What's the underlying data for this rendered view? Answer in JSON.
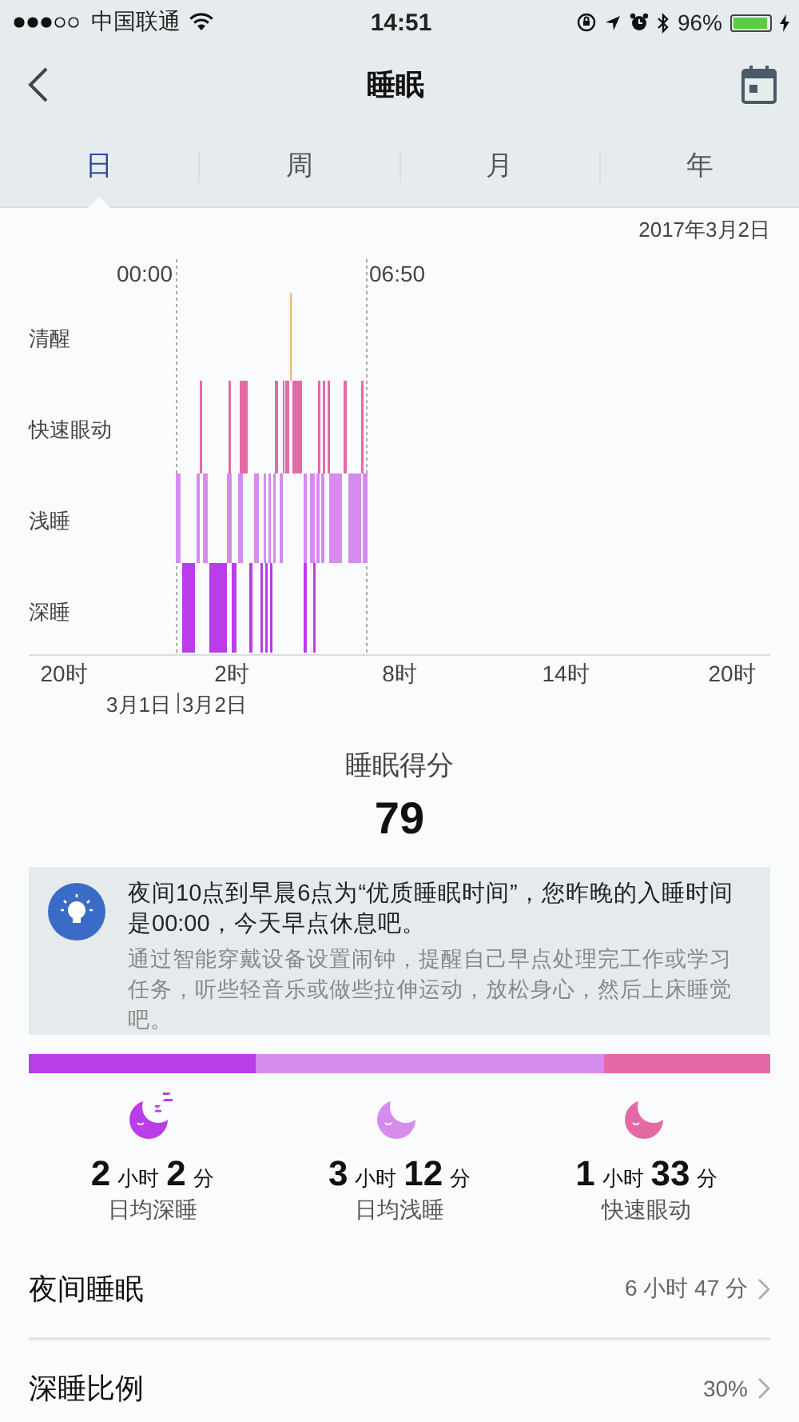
{
  "status_bar": {
    "carrier": "中国联通",
    "time": "14:51",
    "battery": "96%"
  },
  "nav": {
    "title": "睡眠"
  },
  "tabs": [
    {
      "label": "日",
      "selected": true
    },
    {
      "label": "周",
      "selected": false
    },
    {
      "label": "月",
      "selected": false
    },
    {
      "label": "年",
      "selected": false
    }
  ],
  "sleep_chart": {
    "date": "2017年3月2日",
    "sleep_start": "00:00",
    "wake_time": "06:50",
    "stages": [
      {
        "name": "清醒",
        "color": "#f0c070"
      },
      {
        "name": "快速眼动",
        "color": "#e46aa6"
      },
      {
        "name": "浅睡",
        "color": "#d58cec"
      },
      {
        "name": "深睡",
        "color": "#b93de8"
      }
    ],
    "x_labels": [
      "20时",
      "2时",
      "8时",
      "14时",
      "20时"
    ],
    "day_labels": [
      "3月1日",
      "3月2日"
    ]
  },
  "score": {
    "label": "睡眠得分",
    "value": "79"
  },
  "tip": {
    "headline": "夜间10点到早晨6点为“优质睡眠时间”，您昨晚的入睡时间是00:00，今天早点休息吧。",
    "body": "通过智能穿戴设备设置闹钟，提醒自己早点处理完工作或学习任务，听些轻音乐或做些拉伸运动，放松身心，然后上床睡觉吧。"
  },
  "stage_bar": [
    {
      "color": "#b93de8"
    },
    {
      "color": "#d58cec"
    },
    {
      "color": "#e46aa6"
    }
  ],
  "summary": [
    {
      "hours": "2",
      "hours_unit": "小时",
      "minutes": "2",
      "minutes_unit": "分",
      "label": "日均深睡",
      "color": "#b93de8",
      "zzz": true
    },
    {
      "hours": "3",
      "hours_unit": "小时",
      "minutes": "12",
      "minutes_unit": "分",
      "label": "日均浅睡",
      "color": "#d58cec",
      "zzz": false
    },
    {
      "hours": "1",
      "hours_unit": "小时",
      "minutes": "33",
      "minutes_unit": "分",
      "label": "快速眼动",
      "color": "#e46aa6",
      "zzz": false
    }
  ],
  "rows": [
    {
      "label": "夜间睡眠",
      "value": "6 小时 47 分"
    },
    {
      "label": "深睡比例",
      "value": "30%"
    }
  ]
}
